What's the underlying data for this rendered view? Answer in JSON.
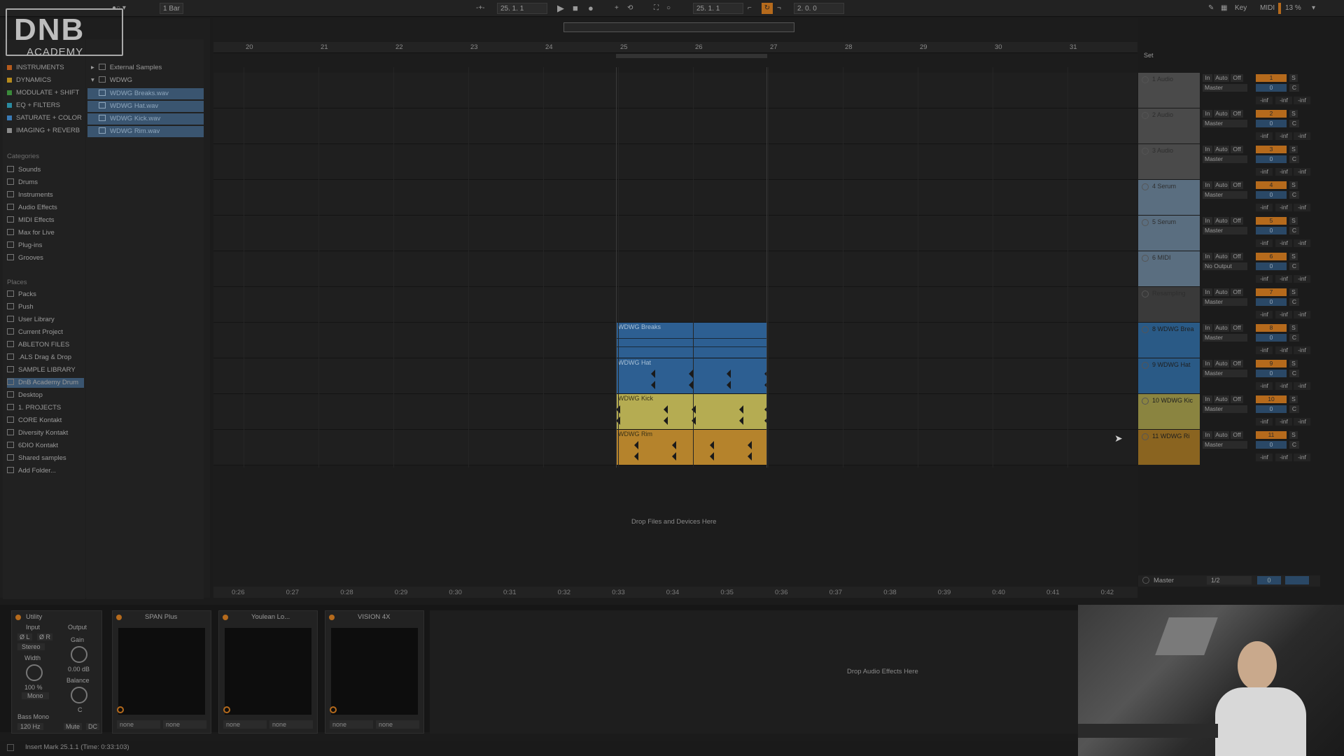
{
  "logo": {
    "big": "DNB",
    "small": "ACADEMY"
  },
  "transport": {
    "position": "25.  1.  1",
    "loop_start": "25.  1.  1",
    "loop_length": "2.  0.  0",
    "quantize": "1 Bar",
    "key_label": "Key",
    "midi_label": "MIDI",
    "cpu": "13 %"
  },
  "collections": [
    {
      "label": "INSTRUMENTS",
      "color": "#b55a1c"
    },
    {
      "label": "DYNAMICS",
      "color": "#b58a1c"
    },
    {
      "label": "MODULATE + SHIFT",
      "color": "#3a8a3a"
    },
    {
      "label": "EQ + FILTERS",
      "color": "#2a8aa0"
    },
    {
      "label": "SATURATE + COLOR",
      "color": "#3a7ab5"
    },
    {
      "label": "IMAGING + REVERB",
      "color": "#8a8a8a"
    }
  ],
  "categories": {
    "heading": "Categories",
    "items": [
      "Sounds",
      "Drums",
      "Instruments",
      "Audio Effects",
      "MIDI Effects",
      "Max for Live",
      "Plug-ins",
      "Grooves"
    ]
  },
  "places": {
    "heading": "Places",
    "items": [
      "Packs",
      "Push",
      "User Library",
      "Current Project",
      "ABLETON FILES",
      ".ALS Drag & Drop",
      "SAMPLE LIBRARY",
      "DnB Academy Drum",
      "Desktop",
      "1. PROJECTS",
      "CORE Kontakt",
      "Diversity Kontakt",
      "6DIO Kontakt",
      "Shared samples",
      "Add Folder..."
    ]
  },
  "folders": [
    "External Samples",
    "WDWG"
  ],
  "files": [
    "WDWG Breaks.wav",
    "WDWG Hat.wav",
    "WDWG Kick.wav",
    "WDWG Rim.wav"
  ],
  "ruler_bars": [
    "20",
    "21",
    "22",
    "23",
    "24",
    "25",
    "26",
    "27",
    "28",
    "29",
    "30",
    "31"
  ],
  "set_label": "Set",
  "tracks": [
    {
      "name": "1 Audio",
      "num": "1",
      "out": "Master",
      "color": "#4a4a4a",
      "clip": null
    },
    {
      "name": "2 Audio",
      "num": "2",
      "out": "Master",
      "color": "#4a4a4a",
      "clip": null
    },
    {
      "name": "3 Audio",
      "num": "3",
      "out": "Master",
      "color": "#4a4a4a",
      "clip": null
    },
    {
      "name": "4 Serum",
      "num": "4",
      "out": "Master",
      "color": "#5a6e80",
      "clip": null
    },
    {
      "name": "5 Serum",
      "num": "5",
      "out": "Master",
      "color": "#5a6e80",
      "clip": null
    },
    {
      "name": "6 MIDI",
      "num": "6",
      "out": "No Output",
      "color": "#5a6e80",
      "clip": null
    },
    {
      "name": "Resampling",
      "num": "7",
      "out": "Master",
      "color": "#3a3a3a",
      "clip": null
    },
    {
      "name": "8 WDWG Brea",
      "num": "8",
      "out": "Master",
      "color": "#2a5a86",
      "clip": "WDWG Breaks"
    },
    {
      "name": "9 WDWG Hat",
      "num": "9",
      "out": "Master",
      "color": "#2a5a86",
      "clip": "WDWG Hat"
    },
    {
      "name": "10 WDWG Kic",
      "num": "10",
      "out": "Master",
      "color": "#8a8440",
      "clip": "WDWG Kick"
    },
    {
      "name": "11 WDWG Ri",
      "num": "11",
      "out": "Master",
      "color": "#8a6420",
      "clip": "WDWG Rim"
    }
  ],
  "io_labels": {
    "in": "In",
    "auto": "Auto",
    "off": "Off",
    "solo": "S",
    "vol": "0",
    "pan": "C",
    "inf": "-inf"
  },
  "drop_files": "Drop Files and Devices Here",
  "master": {
    "name": "Master",
    "quant": "1/2",
    "vol": "0"
  },
  "time_ruler": [
    "0:26",
    "0:27",
    "0:28",
    "0:29",
    "0:30",
    "0:31",
    "0:32",
    "0:33",
    "0:34",
    "0:35",
    "0:36",
    "0:37",
    "0:38",
    "0:39",
    "0:40",
    "0:41",
    "0:42"
  ],
  "devices": {
    "utility": {
      "title": "Utility",
      "input": "Input",
      "output": "Output",
      "left": "Ø L",
      "right": "Ø R",
      "stereo": "Stereo",
      "gain": "Gain",
      "gain_val": "0.00 dB",
      "width": "Width",
      "width_val": "100 %",
      "mono": "Mono",
      "balance": "Balance",
      "balance_val": "C",
      "bass_mono": "Bass Mono",
      "freq": "120 Hz",
      "mute": "Mute",
      "dc": "DC"
    },
    "plugins": [
      {
        "title": "SPAN Plus",
        "sel1": "none",
        "sel2": "none"
      },
      {
        "title": "Youlean Lo...",
        "sel1": "none",
        "sel2": "none"
      },
      {
        "title": "VISION 4X",
        "sel1": "none",
        "sel2": "none"
      }
    ],
    "drop_effects": "Drop Audio Effects Here"
  },
  "status": "Insert Mark 25.1.1 (Time: 0:33:103)"
}
